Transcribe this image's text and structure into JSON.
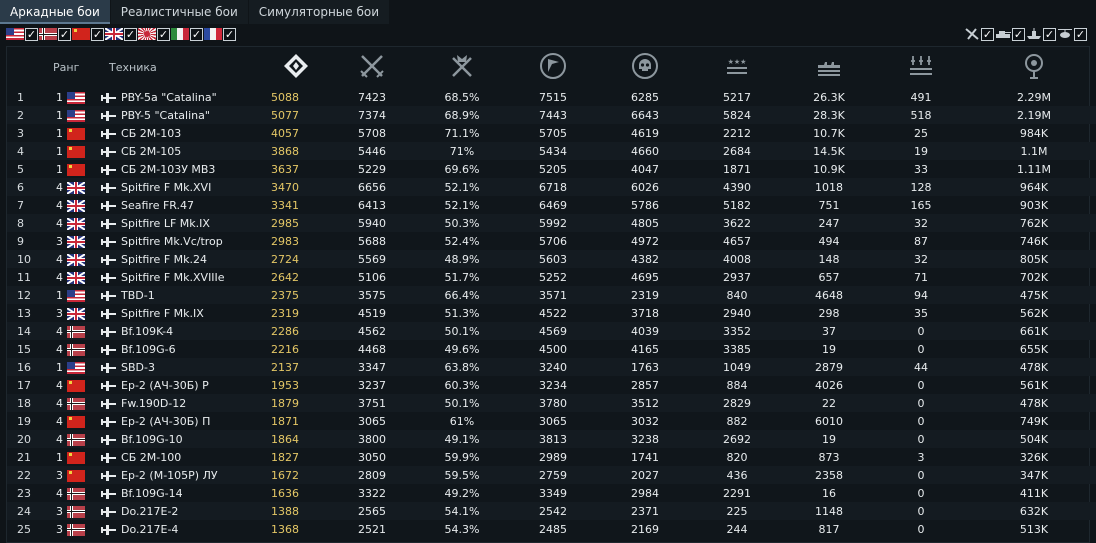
{
  "tabs": [
    {
      "label": "Аркадные бои",
      "active": true
    },
    {
      "label": "Реалистичные бои",
      "active": false
    },
    {
      "label": "Симуляторные бои",
      "active": false
    }
  ],
  "nation_filters": [
    {
      "nation": "usa",
      "checked": true
    },
    {
      "nation": "germany",
      "checked": true
    },
    {
      "nation": "ussr",
      "checked": true
    },
    {
      "nation": "britain",
      "checked": true
    },
    {
      "nation": "japan",
      "checked": true
    },
    {
      "nation": "italy",
      "checked": true
    },
    {
      "nation": "france",
      "checked": true
    }
  ],
  "type_filters": [
    {
      "icon": "aircraft-icon",
      "checked": true
    },
    {
      "icon": "tank-icon",
      "checked": true
    },
    {
      "icon": "ship-icon",
      "checked": true
    },
    {
      "icon": "helicopter-icon",
      "checked": true
    }
  ],
  "columns": {
    "rank": "Ранг",
    "vehicle": "Техника",
    "icons": [
      "rating-icon",
      "battles-icon",
      "win-rate-icon",
      "kills-icon",
      "deaths-icon",
      "air-kills-icon",
      "ground-kills-icon",
      "naval-kills-icon",
      "earnings-icon"
    ]
  },
  "rows": [
    {
      "n": "1",
      "rank": "1",
      "nation": "usa",
      "name": "PBY-5a \"Catalina\"",
      "score": "5088",
      "c1": "7423",
      "c2": "68.5%",
      "c3": "7515",
      "c4": "6285",
      "c5": "5217",
      "c6": "26.3K",
      "c7": "491",
      "c8": "2.29M"
    },
    {
      "n": "2",
      "rank": "1",
      "nation": "usa",
      "name": "PBY-5 \"Catalina\"",
      "score": "5077",
      "c1": "7374",
      "c2": "68.9%",
      "c3": "7443",
      "c4": "6643",
      "c5": "5824",
      "c6": "28.3K",
      "c7": "518",
      "c8": "2.19M"
    },
    {
      "n": "3",
      "rank": "1",
      "nation": "ussr",
      "name": "СБ 2М-103",
      "score": "4057",
      "c1": "5708",
      "c2": "71.1%",
      "c3": "5705",
      "c4": "4619",
      "c5": "2212",
      "c6": "10.7K",
      "c7": "25",
      "c8": "984K"
    },
    {
      "n": "4",
      "rank": "1",
      "nation": "ussr",
      "name": "СБ 2М-105",
      "score": "3868",
      "c1": "5446",
      "c2": "71%",
      "c3": "5434",
      "c4": "4660",
      "c5": "2684",
      "c6": "14.5K",
      "c7": "19",
      "c8": "1.1M"
    },
    {
      "n": "5",
      "rank": "1",
      "nation": "ussr",
      "name": "СБ 2М-103У МВ3",
      "score": "3637",
      "c1": "5229",
      "c2": "69.6%",
      "c3": "5205",
      "c4": "4047",
      "c5": "1871",
      "c6": "10.9K",
      "c7": "33",
      "c8": "1.11M"
    },
    {
      "n": "6",
      "rank": "4",
      "nation": "britain",
      "name": "Spitfire F Mk.XVI",
      "score": "3470",
      "c1": "6656",
      "c2": "52.1%",
      "c3": "6718",
      "c4": "6026",
      "c5": "4390",
      "c6": "1018",
      "c7": "128",
      "c8": "964K"
    },
    {
      "n": "7",
      "rank": "4",
      "nation": "britain",
      "name": "Seafire FR.47",
      "score": "3341",
      "c1": "6413",
      "c2": "52.1%",
      "c3": "6469",
      "c4": "5786",
      "c5": "5182",
      "c6": "751",
      "c7": "165",
      "c8": "903K"
    },
    {
      "n": "8",
      "rank": "4",
      "nation": "britain",
      "name": "Spitfire LF Mk.IX",
      "score": "2985",
      "c1": "5940",
      "c2": "50.3%",
      "c3": "5992",
      "c4": "4805",
      "c5": "3622",
      "c6": "247",
      "c7": "32",
      "c8": "762K"
    },
    {
      "n": "9",
      "rank": "3",
      "nation": "britain",
      "name": "Spitfire Mk.Vc/trop",
      "score": "2983",
      "c1": "5688",
      "c2": "52.4%",
      "c3": "5706",
      "c4": "4972",
      "c5": "4657",
      "c6": "494",
      "c7": "87",
      "c8": "746K"
    },
    {
      "n": "10",
      "rank": "4",
      "nation": "britain",
      "name": "Spitfire F Mk.24",
      "score": "2724",
      "c1": "5569",
      "c2": "48.9%",
      "c3": "5603",
      "c4": "4382",
      "c5": "4008",
      "c6": "148",
      "c7": "32",
      "c8": "805K"
    },
    {
      "n": "11",
      "rank": "4",
      "nation": "britain",
      "name": "Spitfire F Mk.XVIIIe",
      "score": "2642",
      "c1": "5106",
      "c2": "51.7%",
      "c3": "5252",
      "c4": "4695",
      "c5": "2937",
      "c6": "657",
      "c7": "71",
      "c8": "702K"
    },
    {
      "n": "12",
      "rank": "1",
      "nation": "usa",
      "name": "TBD-1",
      "score": "2375",
      "c1": "3575",
      "c2": "66.4%",
      "c3": "3571",
      "c4": "2319",
      "c5": "840",
      "c6": "4648",
      "c7": "94",
      "c8": "475K"
    },
    {
      "n": "13",
      "rank": "3",
      "nation": "britain",
      "name": "Spitfire F Mk.IX",
      "score": "2319",
      "c1": "4519",
      "c2": "51.3%",
      "c3": "4522",
      "c4": "3718",
      "c5": "2940",
      "c6": "298",
      "c7": "35",
      "c8": "562K"
    },
    {
      "n": "14",
      "rank": "4",
      "nation": "germany",
      "name": "Bf.109K-4",
      "score": "2286",
      "c1": "4562",
      "c2": "50.1%",
      "c3": "4569",
      "c4": "4039",
      "c5": "3352",
      "c6": "37",
      "c7": "0",
      "c8": "661K"
    },
    {
      "n": "15",
      "rank": "4",
      "nation": "germany",
      "name": "Bf.109G-6",
      "score": "2216",
      "c1": "4468",
      "c2": "49.6%",
      "c3": "4500",
      "c4": "4165",
      "c5": "3385",
      "c6": "19",
      "c7": "0",
      "c8": "655K"
    },
    {
      "n": "16",
      "rank": "1",
      "nation": "usa",
      "name": "SBD-3",
      "score": "2137",
      "c1": "3347",
      "c2": "63.8%",
      "c3": "3240",
      "c4": "1763",
      "c5": "1049",
      "c6": "2879",
      "c7": "44",
      "c8": "478K"
    },
    {
      "n": "17",
      "rank": "4",
      "nation": "ussr",
      "name": "Ер-2 (АЧ-30Б) Р",
      "score": "1953",
      "c1": "3237",
      "c2": "60.3%",
      "c3": "3234",
      "c4": "2857",
      "c5": "884",
      "c6": "4026",
      "c7": "0",
      "c8": "561K"
    },
    {
      "n": "18",
      "rank": "4",
      "nation": "germany",
      "name": "Fw.190D-12",
      "score": "1879",
      "c1": "3751",
      "c2": "50.1%",
      "c3": "3780",
      "c4": "3512",
      "c5": "2829",
      "c6": "22",
      "c7": "0",
      "c8": "478K"
    },
    {
      "n": "19",
      "rank": "4",
      "nation": "ussr",
      "name": "Ер-2 (АЧ-30Б) П",
      "score": "1871",
      "c1": "3065",
      "c2": "61%",
      "c3": "3065",
      "c4": "3032",
      "c5": "882",
      "c6": "6010",
      "c7": "0",
      "c8": "749K"
    },
    {
      "n": "20",
      "rank": "4",
      "nation": "germany",
      "name": "Bf.109G-10",
      "score": "1864",
      "c1": "3800",
      "c2": "49.1%",
      "c3": "3813",
      "c4": "3238",
      "c5": "2692",
      "c6": "19",
      "c7": "0",
      "c8": "504K"
    },
    {
      "n": "21",
      "rank": "1",
      "nation": "ussr",
      "name": "СБ 2М-100",
      "score": "1827",
      "c1": "3050",
      "c2": "59.9%",
      "c3": "2989",
      "c4": "1741",
      "c5": "820",
      "c6": "873",
      "c7": "3",
      "c8": "326K"
    },
    {
      "n": "22",
      "rank": "3",
      "nation": "ussr",
      "name": "Ер-2 (М-105Р) ЛУ",
      "score": "1672",
      "c1": "2809",
      "c2": "59.5%",
      "c3": "2759",
      "c4": "2027",
      "c5": "436",
      "c6": "2358",
      "c7": "0",
      "c8": "347K"
    },
    {
      "n": "23",
      "rank": "4",
      "nation": "germany",
      "name": "Bf.109G-14",
      "score": "1636",
      "c1": "3322",
      "c2": "49.2%",
      "c3": "3349",
      "c4": "2984",
      "c5": "2291",
      "c6": "16",
      "c7": "0",
      "c8": "411K"
    },
    {
      "n": "24",
      "rank": "3",
      "nation": "germany",
      "name": "Do.217E-2",
      "score": "1388",
      "c1": "2565",
      "c2": "54.1%",
      "c3": "2542",
      "c4": "2371",
      "c5": "225",
      "c6": "1148",
      "c7": "0",
      "c8": "632K"
    },
    {
      "n": "25",
      "rank": "3",
      "nation": "germany",
      "name": "Do.217E-4",
      "score": "1368",
      "c1": "2521",
      "c2": "54.3%",
      "c3": "2485",
      "c4": "2169",
      "c5": "244",
      "c6": "817",
      "c7": "0",
      "c8": "513K"
    }
  ],
  "colors": {
    "score": "#e4c766",
    "tab_active": "#2b3b49",
    "background": "#0f1418"
  }
}
